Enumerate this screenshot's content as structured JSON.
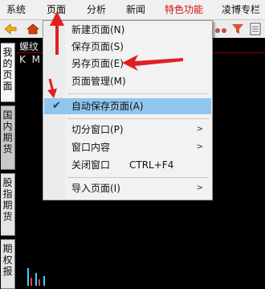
{
  "menubar": {
    "items": [
      "系统",
      "页面",
      "分析",
      "新闻",
      "特色功能",
      "凌博专栏"
    ]
  },
  "chart": {
    "title": "螺纹",
    "sub": "K M"
  },
  "left_tabs": [
    {
      "label": [
        "我",
        "的",
        "页",
        "面"
      ]
    },
    {
      "label": [
        "国",
        "内",
        "期",
        "货"
      ]
    },
    {
      "label": [
        "股",
        "指",
        "期",
        "货"
      ]
    },
    {
      "label": [
        "期",
        "权",
        "报"
      ]
    }
  ],
  "popup": {
    "items": [
      {
        "label": "新建页面(N)"
      },
      {
        "label": "保存页面(S)"
      },
      {
        "label": "另存页面(E)"
      },
      {
        "label": "页面管理(M)"
      },
      {
        "label": "自动保存页面(A)",
        "checked": true
      },
      {
        "label": "切分窗口(P)",
        "submenu": true
      },
      {
        "label": "窗口内容",
        "submenu": true
      },
      {
        "label": "关闭窗口",
        "shortcut": "CTRL+F4"
      },
      {
        "label": "导入页面(I)",
        "submenu": true
      }
    ],
    "check_glyph": "✔",
    "arrow_glyph": ">"
  },
  "colors": {
    "highlight": "#90c6ee",
    "annotation": "#e02020",
    "special_menu": "#d01010"
  }
}
